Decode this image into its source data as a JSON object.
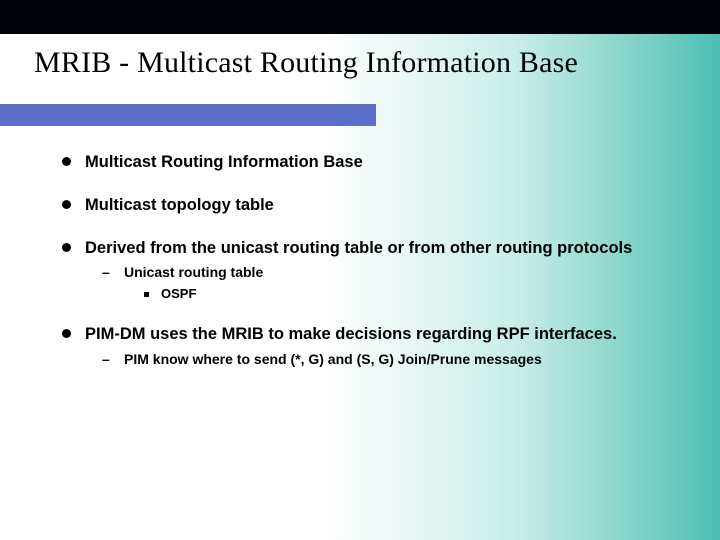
{
  "title": "MRIB - Multicast Routing Information Base",
  "items": [
    {
      "text": "Multicast Routing Information Base"
    },
    {
      "text": "Multicast topology table"
    },
    {
      "text": "Derived from the unicast routing table or from other routing protocols",
      "sub": [
        {
          "text": "Unicast routing table",
          "sub": [
            {
              "text": "OSPF"
            }
          ]
        }
      ]
    },
    {
      "text": "PIM-DM uses the MRIB to make decisions regarding RPF interfaces.",
      "sub": [
        {
          "text": "PIM know where to send (*, G) and (S, G) Join/Prune messages"
        }
      ]
    }
  ]
}
